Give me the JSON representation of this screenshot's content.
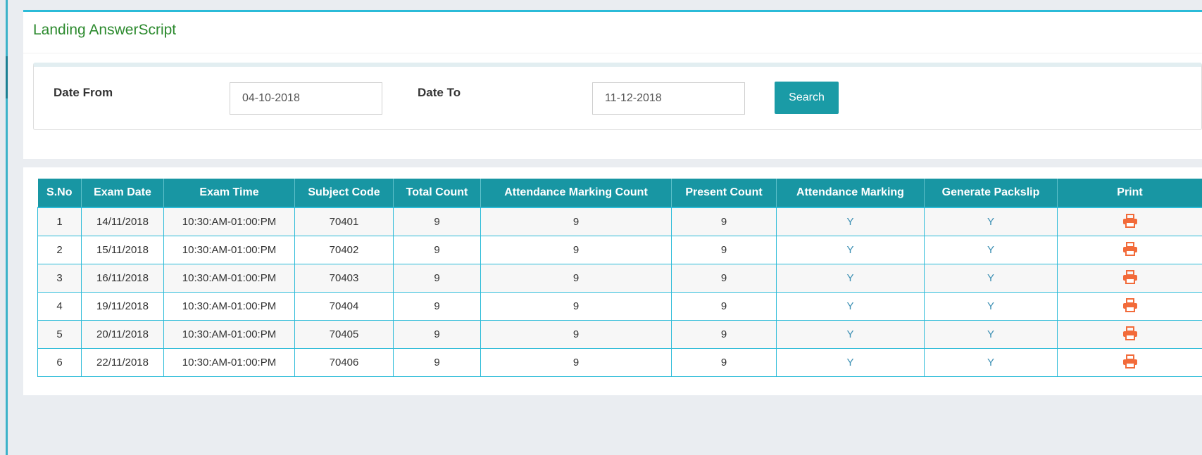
{
  "page": {
    "title": "Landing AnswerScript"
  },
  "filter": {
    "date_from_label": "Date From",
    "date_from_value": "04-10-2018",
    "date_to_label": "Date To",
    "date_to_value": "11-12-2018",
    "search_label": "Search"
  },
  "table": {
    "headers": [
      "S.No",
      "Exam Date",
      "Exam Time",
      "Subject Code",
      "Total Count",
      "Attendance Marking Count",
      "Present Count",
      "Attendance Marking",
      "Generate Packslip",
      "Print"
    ],
    "rows": [
      [
        "1",
        "14/11/2018",
        "10:30:AM-01:00:PM",
        "70401",
        "9",
        "9",
        "9",
        "Y",
        "Y"
      ],
      [
        "2",
        "15/11/2018",
        "10:30:AM-01:00:PM",
        "70402",
        "9",
        "9",
        "9",
        "Y",
        "Y"
      ],
      [
        "3",
        "16/11/2018",
        "10:30:AM-01:00:PM",
        "70403",
        "9",
        "9",
        "9",
        "Y",
        "Y"
      ],
      [
        "4",
        "19/11/2018",
        "10:30:AM-01:00:PM",
        "70404",
        "9",
        "9",
        "9",
        "Y",
        "Y"
      ],
      [
        "5",
        "20/11/2018",
        "10:30:AM-01:00:PM",
        "70405",
        "9",
        "9",
        "9",
        "Y",
        "Y"
      ],
      [
        "6",
        "22/11/2018",
        "10:30:AM-01:00:PM",
        "70406",
        "9",
        "9",
        "9",
        "Y",
        "Y"
      ]
    ]
  },
  "icons": {
    "print": "printer-icon"
  },
  "colors": {
    "accent": "#1896a3",
    "title": "#2c8a2e",
    "print_icon": "#f26b3a",
    "link": "#3b8fb3"
  }
}
